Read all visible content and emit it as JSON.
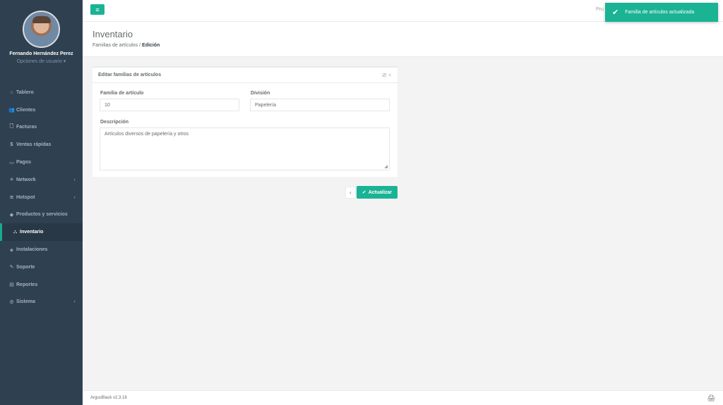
{
  "sidebar": {
    "user_name": "Fernando Hernández Perez",
    "user_options": "Opciones de usuario ▾",
    "items": [
      {
        "label": "Tablero",
        "icon": "⌂"
      },
      {
        "label": "Clientes",
        "icon": "👥"
      },
      {
        "label": "Facturas",
        "icon": "🗋"
      },
      {
        "label": "Ventas rápidas",
        "icon": "$"
      },
      {
        "label": "Pagos",
        "icon": "▭"
      },
      {
        "label": "Network",
        "icon": "✳",
        "caret": "‹"
      },
      {
        "label": "Hotspot",
        "icon": "≋",
        "caret": "‹"
      },
      {
        "label": "Productos y servicios",
        "icon": "◆"
      },
      {
        "label": "Inventario",
        "icon": "⛬"
      },
      {
        "label": "Instalaciones",
        "icon": "◈"
      },
      {
        "label": "Soporte",
        "icon": "✎"
      },
      {
        "label": "Reportes",
        "icon": "▤"
      },
      {
        "label": "Sistema",
        "icon": "⚙",
        "caret": "‹"
      }
    ]
  },
  "topbar": {
    "menu_icon": "≡",
    "user_label": "Pru"
  },
  "heading": {
    "title": "Inventario",
    "crumb_1": "Familias de artículos",
    "crumb_sep": " / ",
    "crumb_active": "Edición"
  },
  "card": {
    "title": "Editar familias de artículos",
    "tools": "⎚ ✕",
    "familia_label": "Familia de artículo",
    "familia_value": "10",
    "division_label": "División",
    "division_value": "Papelería",
    "descripcion_label": "Descripción",
    "descripcion_value": "Artículos diversos de papelería y otros"
  },
  "actions": {
    "back": "‹",
    "save_icon": "✔",
    "save_label": "Actualizar"
  },
  "toast": {
    "icon": "✔",
    "message": "Familia de artículos actualizada"
  },
  "footer": {
    "version": "ArgusBlack v2.3.18",
    "icon": "🖨"
  },
  "colors": {
    "accent": "#1ab394",
    "sidebar": "#2f4050"
  }
}
